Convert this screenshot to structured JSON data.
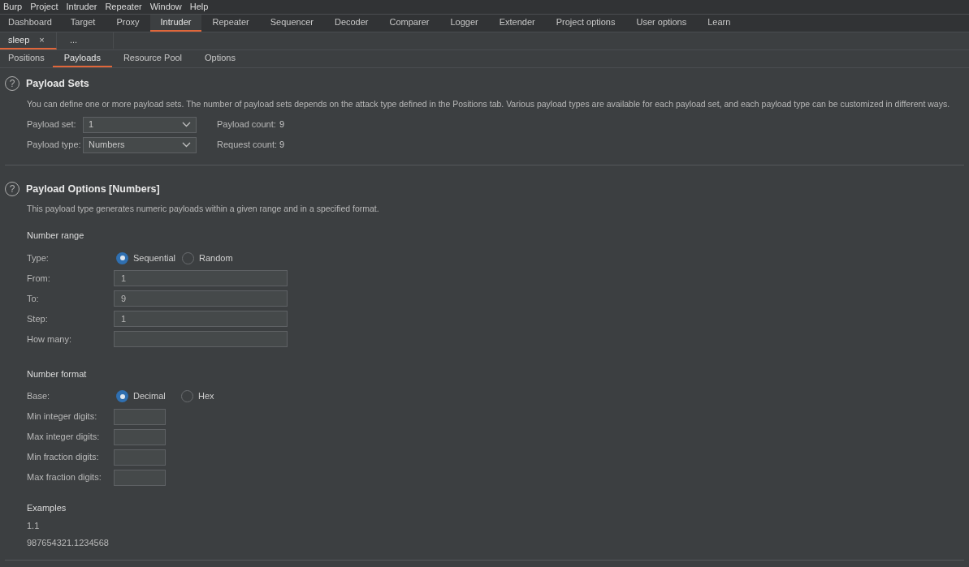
{
  "menu_bar": [
    "Burp",
    "Project",
    "Intruder",
    "Repeater",
    "Window",
    "Help"
  ],
  "main_tabs": [
    {
      "label": "Dashboard",
      "selected": false
    },
    {
      "label": "Target",
      "selected": false
    },
    {
      "label": "Proxy",
      "selected": false
    },
    {
      "label": "Intruder",
      "selected": true
    },
    {
      "label": "Repeater",
      "selected": false
    },
    {
      "label": "Sequencer",
      "selected": false
    },
    {
      "label": "Decoder",
      "selected": false
    },
    {
      "label": "Comparer",
      "selected": false
    },
    {
      "label": "Logger",
      "selected": false
    },
    {
      "label": "Extender",
      "selected": false
    },
    {
      "label": "Project options",
      "selected": false
    },
    {
      "label": "User options",
      "selected": false
    },
    {
      "label": "Learn",
      "selected": false
    }
  ],
  "attack_tabs": [
    {
      "label": "sleep",
      "close": "×",
      "selected": true
    },
    {
      "label": "...",
      "selected": false
    }
  ],
  "sub_tabs": [
    {
      "label": "Positions",
      "selected": false
    },
    {
      "label": "Payloads",
      "selected": true
    },
    {
      "label": "Resource Pool",
      "selected": false
    },
    {
      "label": "Options",
      "selected": false
    }
  ],
  "payload_sets": {
    "help": "?",
    "title": "Payload Sets",
    "description": "You can define one or more payload sets. The number of payload sets depends on the attack type defined in the Positions tab. Various payload types are available for each payload set, and each payload type can be customized in different ways.",
    "fields": [
      {
        "label": "Payload set:",
        "value": "1",
        "count_label": "Payload count:",
        "count": "9"
      },
      {
        "label": "Payload type:",
        "value": "Numbers",
        "count_label": "Request count:",
        "count": "9"
      }
    ]
  },
  "payload_options": {
    "help": "?",
    "title": "Payload Options [Numbers]",
    "description": "This payload type generates numeric payloads within a given range and in a specified format.",
    "number_range": {
      "heading": "Number range",
      "type_label": "Type:",
      "options": [
        {
          "label": "Sequential",
          "selected": true
        },
        {
          "label": "Random",
          "selected": false
        }
      ],
      "fields": [
        {
          "label": "From:",
          "value": "1"
        },
        {
          "label": "To:",
          "value": "9"
        },
        {
          "label": "Step:",
          "value": "1"
        },
        {
          "label": "How many:"
        }
      ]
    },
    "number_format": {
      "heading": "Number format",
      "base_label": "Base:",
      "options": [
        {
          "label": "Decimal",
          "selected": true
        },
        {
          "label": "Hex",
          "selected": false
        }
      ],
      "fields": [
        {
          "label": "Min integer digits:"
        },
        {
          "label": "Max integer digits:"
        },
        {
          "label": "Min fraction digits:"
        },
        {
          "label": "Max fraction digits:"
        }
      ]
    },
    "examples": {
      "heading": "Examples",
      "values": [
        "1.1",
        "987654321.1234568"
      ]
    }
  }
}
